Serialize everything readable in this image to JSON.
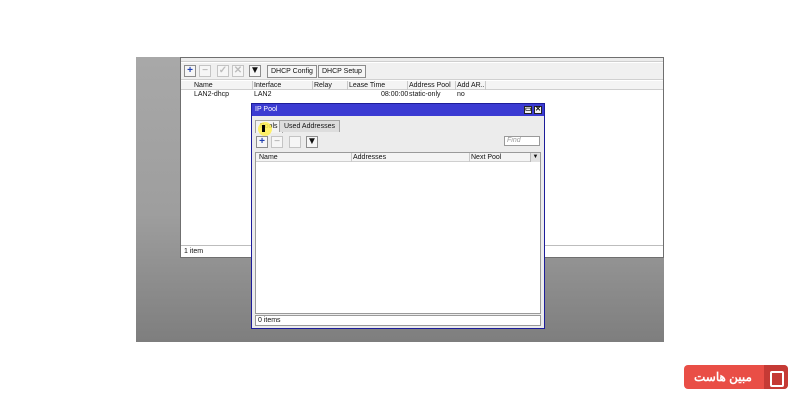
{
  "dhcp_window": {
    "toolbar": {
      "dhcp_config_label": "DHCP Config",
      "dhcp_setup_label": "DHCP Setup"
    },
    "columns": [
      "Name",
      "Interface",
      "Relay",
      "Lease Time",
      "Address Pool",
      "Add AR..."
    ],
    "rows": [
      {
        "name": "LAN2-dhcp",
        "interface": "LAN2",
        "relay": "",
        "lease_time": "08:00:00",
        "address_pool": "static-only",
        "add_arp": "no"
      }
    ],
    "status": "1 item"
  },
  "ip_pool_window": {
    "title": "IP Pool",
    "tabs": [
      "Pools",
      "Used Addresses"
    ],
    "active_tab": "Pools",
    "find_placeholder": "Find",
    "columns": [
      "Name",
      "Addresses",
      "Next Pool"
    ],
    "status": "0 items"
  },
  "watermark": {
    "text": "مبین هاست",
    "color": "#e94e46"
  },
  "icons": {
    "add": "+",
    "remove": "−",
    "enable": "✓",
    "disable": "✕",
    "filter": "▼",
    "minimize": "▭",
    "close": "✕",
    "dropdown": "▼"
  }
}
